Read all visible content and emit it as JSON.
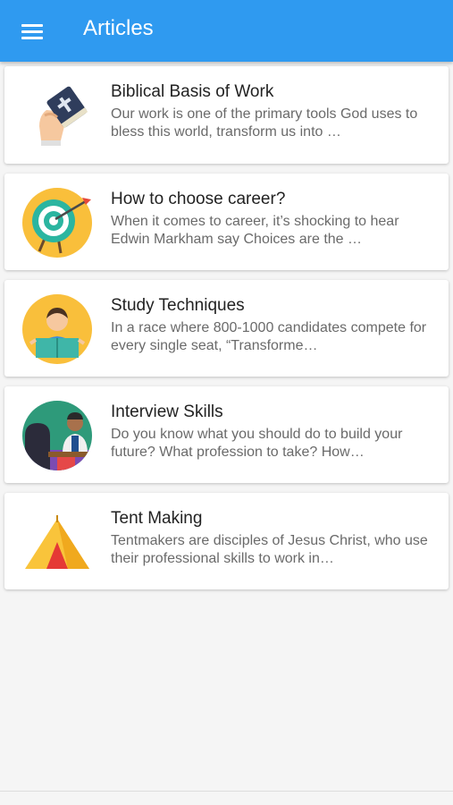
{
  "appbar": {
    "title": "Articles",
    "menu_icon": "hamburger-menu-icon"
  },
  "articles": [
    {
      "title": "Biblical Basis of Work",
      "description": "Our work is one of the primary tools God uses to bless this world, transform us into …",
      "icon": "bible-hand-icon"
    },
    {
      "title": "How to choose career?",
      "description": "When it comes to career, it’s shocking to hear Edwin Markham say Choices are the …",
      "icon": "target-arrow-icon"
    },
    {
      "title": "Study Techniques",
      "description": "In a race where 800-1000 candidates compete for every single seat, “Transforme…",
      "icon": "student-reading-icon"
    },
    {
      "title": "Interview Skills",
      "description": "Do you know what you should do to build your future? What profession to take? How…",
      "icon": "interview-person-icon"
    },
    {
      "title": "Tent Making",
      "description": "Tentmakers are disciples of Jesus Christ, who use their professional skills to work in…",
      "icon": "tent-icon"
    }
  ],
  "colors": {
    "appbar": "#2f9af0",
    "background": "#f5f5f5",
    "card": "#ffffff"
  }
}
